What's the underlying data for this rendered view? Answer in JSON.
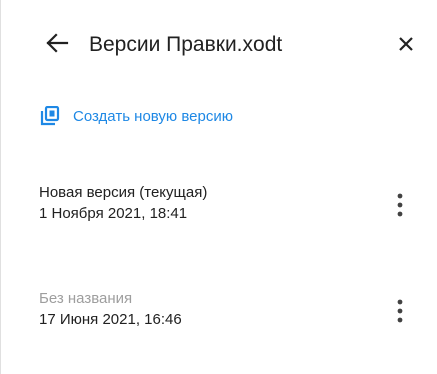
{
  "header": {
    "title": "Версии Правки.xodt",
    "back_icon": "arrow-left-icon",
    "close_icon": "close-icon"
  },
  "create_version": {
    "label": "Создать новую версию",
    "icon": "new-version-icon",
    "color": "#1e88e5"
  },
  "versions": [
    {
      "name": "Новая версия (текущая)",
      "date": "1 Ноября 2021, 18:41",
      "menu_icon": "more-vertical-icon"
    },
    {
      "name": "Без названия",
      "date": "17 Июня 2021, 16:46",
      "menu_icon": "more-vertical-icon"
    }
  ]
}
